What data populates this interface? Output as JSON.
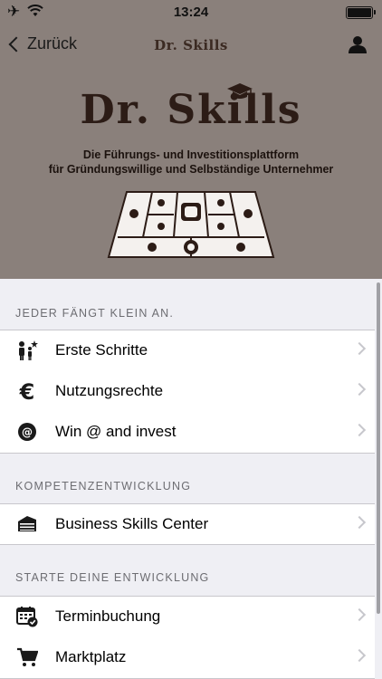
{
  "status_bar": {
    "time": "13:24"
  },
  "nav": {
    "back_label": "Zurück",
    "title": "Dr. Skills"
  },
  "hero": {
    "brand": "Dr. Skills",
    "subtitle_line1": "Die Führungs- und Investitionsplattform",
    "subtitle_line2": "für Gründungswillige und Selbständige Unternehmer"
  },
  "sections": [
    {
      "header": "JEDER FÄNGT KLEIN AN.",
      "items": [
        {
          "label": "Erste Schritte",
          "icon": "people-growth-icon"
        },
        {
          "label": "Nutzungsrechte",
          "icon": "euro-icon"
        },
        {
          "label": "Win @ and invest",
          "icon": "at-sign-icon"
        }
      ]
    },
    {
      "header": "KOMPETENZENTWICKLUNG",
      "items": [
        {
          "label": "Business Skills Center",
          "icon": "building-icon"
        }
      ]
    },
    {
      "header": "STARTE DEINE ENTWICKLUNG",
      "items": [
        {
          "label": "Terminbuchung",
          "icon": "calendar-check-icon"
        },
        {
          "label": "Marktplatz",
          "icon": "shopping-cart-icon"
        }
      ]
    }
  ],
  "colors": {
    "header_bg": "#8a807b",
    "brand_text": "#2c1c16",
    "list_bg": "#efeff4"
  }
}
